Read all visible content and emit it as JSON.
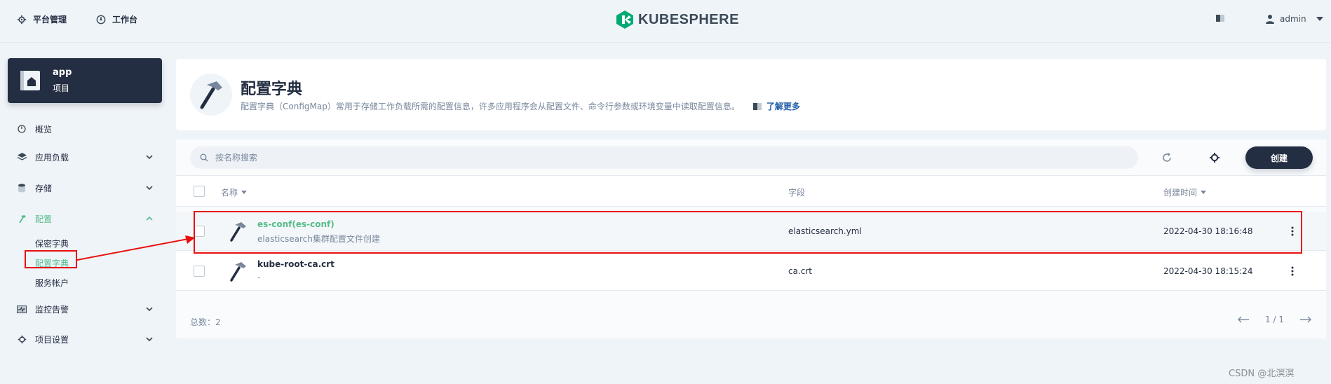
{
  "header": {
    "platform_label": "平台管理",
    "workbench_label": "工作台",
    "logo_text": "KUBESPHERE",
    "user_name": "admin"
  },
  "project": {
    "name": "app",
    "type_label": "项目"
  },
  "sidebar": {
    "items": [
      {
        "label": "概览"
      },
      {
        "label": "应用负载"
      },
      {
        "label": "存储"
      },
      {
        "label": "配置"
      },
      {
        "label": "监控告警"
      },
      {
        "label": "项目设置"
      }
    ],
    "config_children": [
      {
        "label": "保密字典"
      },
      {
        "label": "配置字典"
      },
      {
        "label": "服务帐户"
      }
    ]
  },
  "banner": {
    "title": "配置字典",
    "description": "配置字典（ConfigMap）常用于存储工作负载所需的配置信息，许多应用程序会从配置文件、命令行参数或环境变量中读取配置信息。",
    "learn_more": "了解更多"
  },
  "toolbar": {
    "search_placeholder": "按名称搜索",
    "create_label": "创建"
  },
  "table": {
    "columns": [
      "名称",
      "字段",
      "创建时间"
    ],
    "rows": [
      {
        "name": "es-conf(es-conf)",
        "description": "elasticsearch集群配置文件创建",
        "field": "elasticsearch.yml",
        "created": "2022-04-30 18:16:48"
      },
      {
        "name": "kube-root-ca.crt",
        "description": "-",
        "field": "ca.crt",
        "created": "2022-04-30 18:15:24"
      }
    ],
    "total_label": "总数：2",
    "page_info": "1 / 1"
  },
  "watermark": "CSDN @北溟溟",
  "colors": {
    "accent_green": "#55bc8a",
    "dark": "#242e42",
    "highlight_red": "#e8100e"
  }
}
